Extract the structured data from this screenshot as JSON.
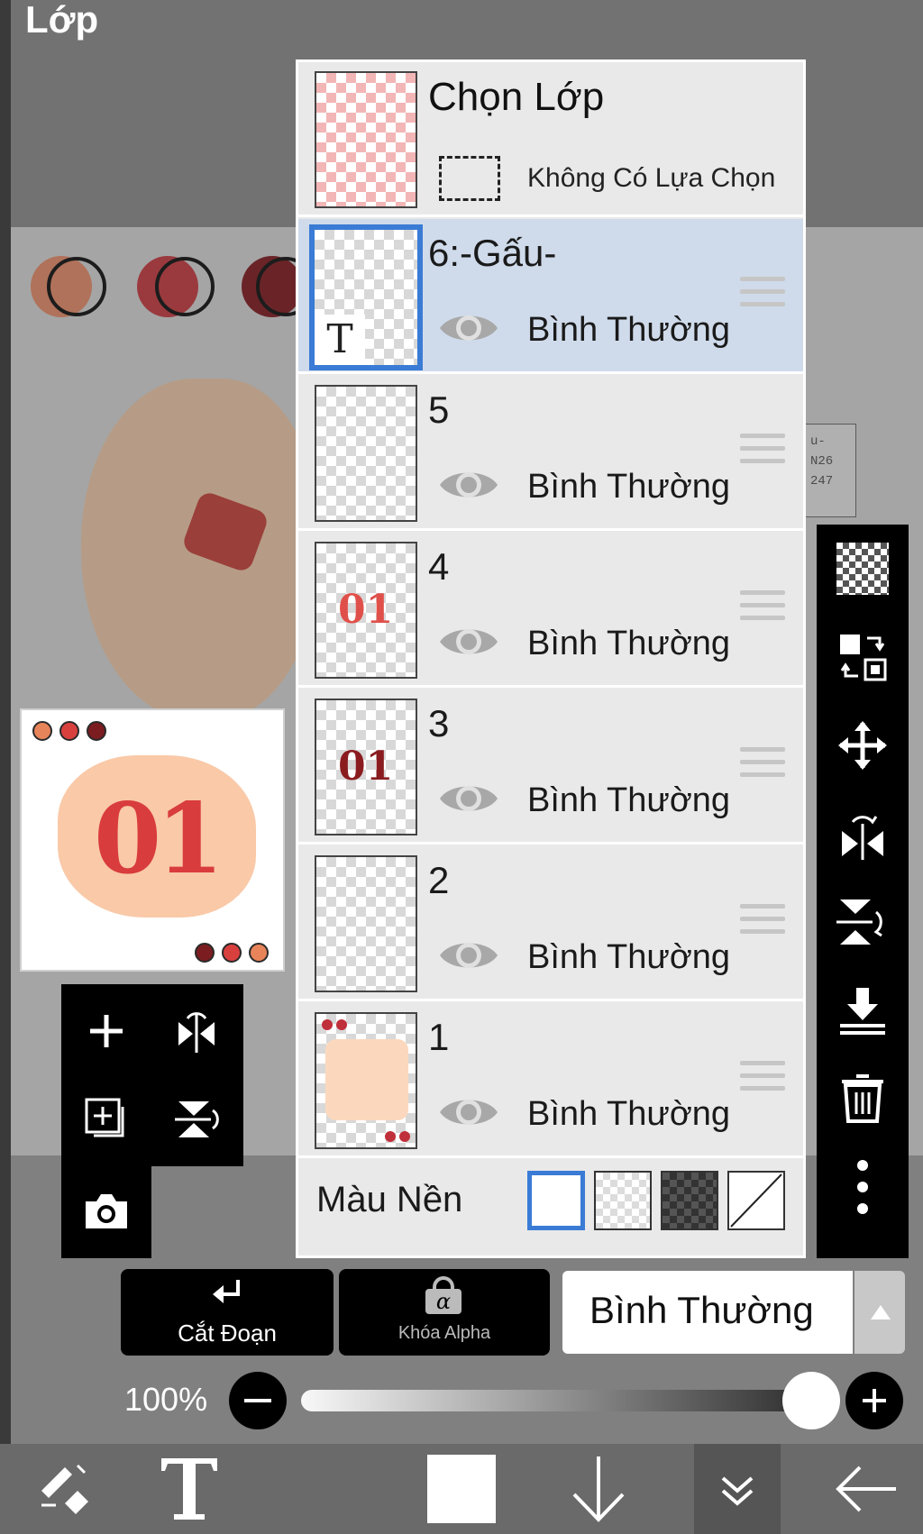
{
  "screen": {
    "title": "Lớp"
  },
  "layer_panel": {
    "selection": {
      "title": "Chọn Lớp",
      "subtitle": "Không Có Lựa Chọn"
    },
    "layers": [
      {
        "name": "6:-Gấu-",
        "mode": "Bình Thường",
        "selected": true,
        "type": "text",
        "thumb_text": "T"
      },
      {
        "name": "5",
        "mode": "Bình Thường",
        "selected": false
      },
      {
        "name": "4",
        "mode": "Bình Thường",
        "selected": false,
        "thumb_text": "01"
      },
      {
        "name": "3",
        "mode": "Bình Thường",
        "selected": false,
        "thumb_text": "01"
      },
      {
        "name": "2",
        "mode": "Bình Thường",
        "selected": false
      },
      {
        "name": "1",
        "mode": "Bình Thường",
        "selected": false
      }
    ],
    "background": {
      "label": "Màu Nền",
      "options": [
        "white",
        "checker-light",
        "checker-dark",
        "none"
      ],
      "selected_index": 0
    }
  },
  "thumbnail": {
    "number": "01"
  },
  "sticker": {
    "lines": [
      "u-",
      "N26",
      "247"
    ]
  },
  "bottom_bar": {
    "clipping_label": "Cắt Đoạn",
    "alpha_lock_label": "Khóa Alpha",
    "alpha_lock_glyph": "α",
    "blend_mode": "Bình Thường",
    "opacity_label": "100%",
    "opacity_value": 100
  },
  "left_tools": [
    "add-layer-icon",
    "flip-horizontal-icon",
    "copy-layer-icon",
    "flip-vertical-icon",
    "camera-icon"
  ],
  "right_tools": [
    "transparency-icon",
    "swap-layers-icon",
    "move-icon",
    "flip-horizontal-icon",
    "flip-vertical-icon",
    "merge-down-icon",
    "trash-icon",
    "more-icon"
  ],
  "bottom_nav": [
    "tools-icon",
    "text-tool-icon",
    "color-swatch-icon",
    "down-arrow-icon",
    "collapse-icon",
    "back-arrow-icon"
  ],
  "colors": {
    "accent": "#3a7bd5",
    "selected_row": "#cfdbeb",
    "panel": "#e9e9e9",
    "toolbar": "#000000"
  }
}
